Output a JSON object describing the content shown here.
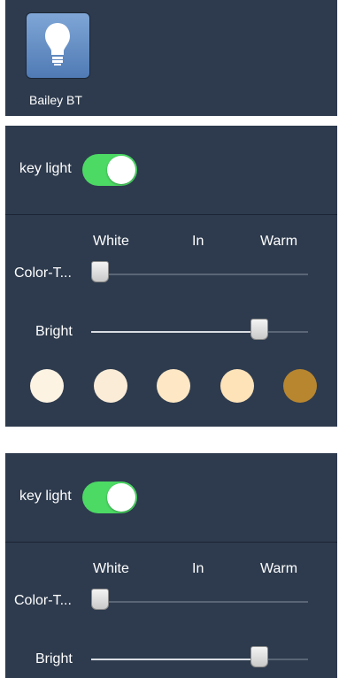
{
  "device": {
    "name": "Bailey BT",
    "icon": "lightbulb-icon",
    "tile_color": "#6b93c8"
  },
  "lights": [
    {
      "title": "key light",
      "on": true,
      "color_temp": {
        "label": "Color-T...",
        "scale_labels": [
          "White",
          "In",
          "Warm"
        ],
        "value_percent": 0
      },
      "brightness": {
        "label": "Bright",
        "value_percent": 77
      },
      "swatches": [
        "#fdf3e3",
        "#fbecd7",
        "#fde7c5",
        "#fee3b8",
        "#b8862f"
      ]
    },
    {
      "title": "key light",
      "on": true,
      "color_temp": {
        "label": "Color-T...",
        "scale_labels": [
          "White",
          "In",
          "Warm"
        ],
        "value_percent": 0
      },
      "brightness": {
        "label": "Bright",
        "value_percent": 77
      }
    }
  ],
  "colors": {
    "panel_bg": "#2e3b4e",
    "toggle_on": "#4cd964"
  }
}
